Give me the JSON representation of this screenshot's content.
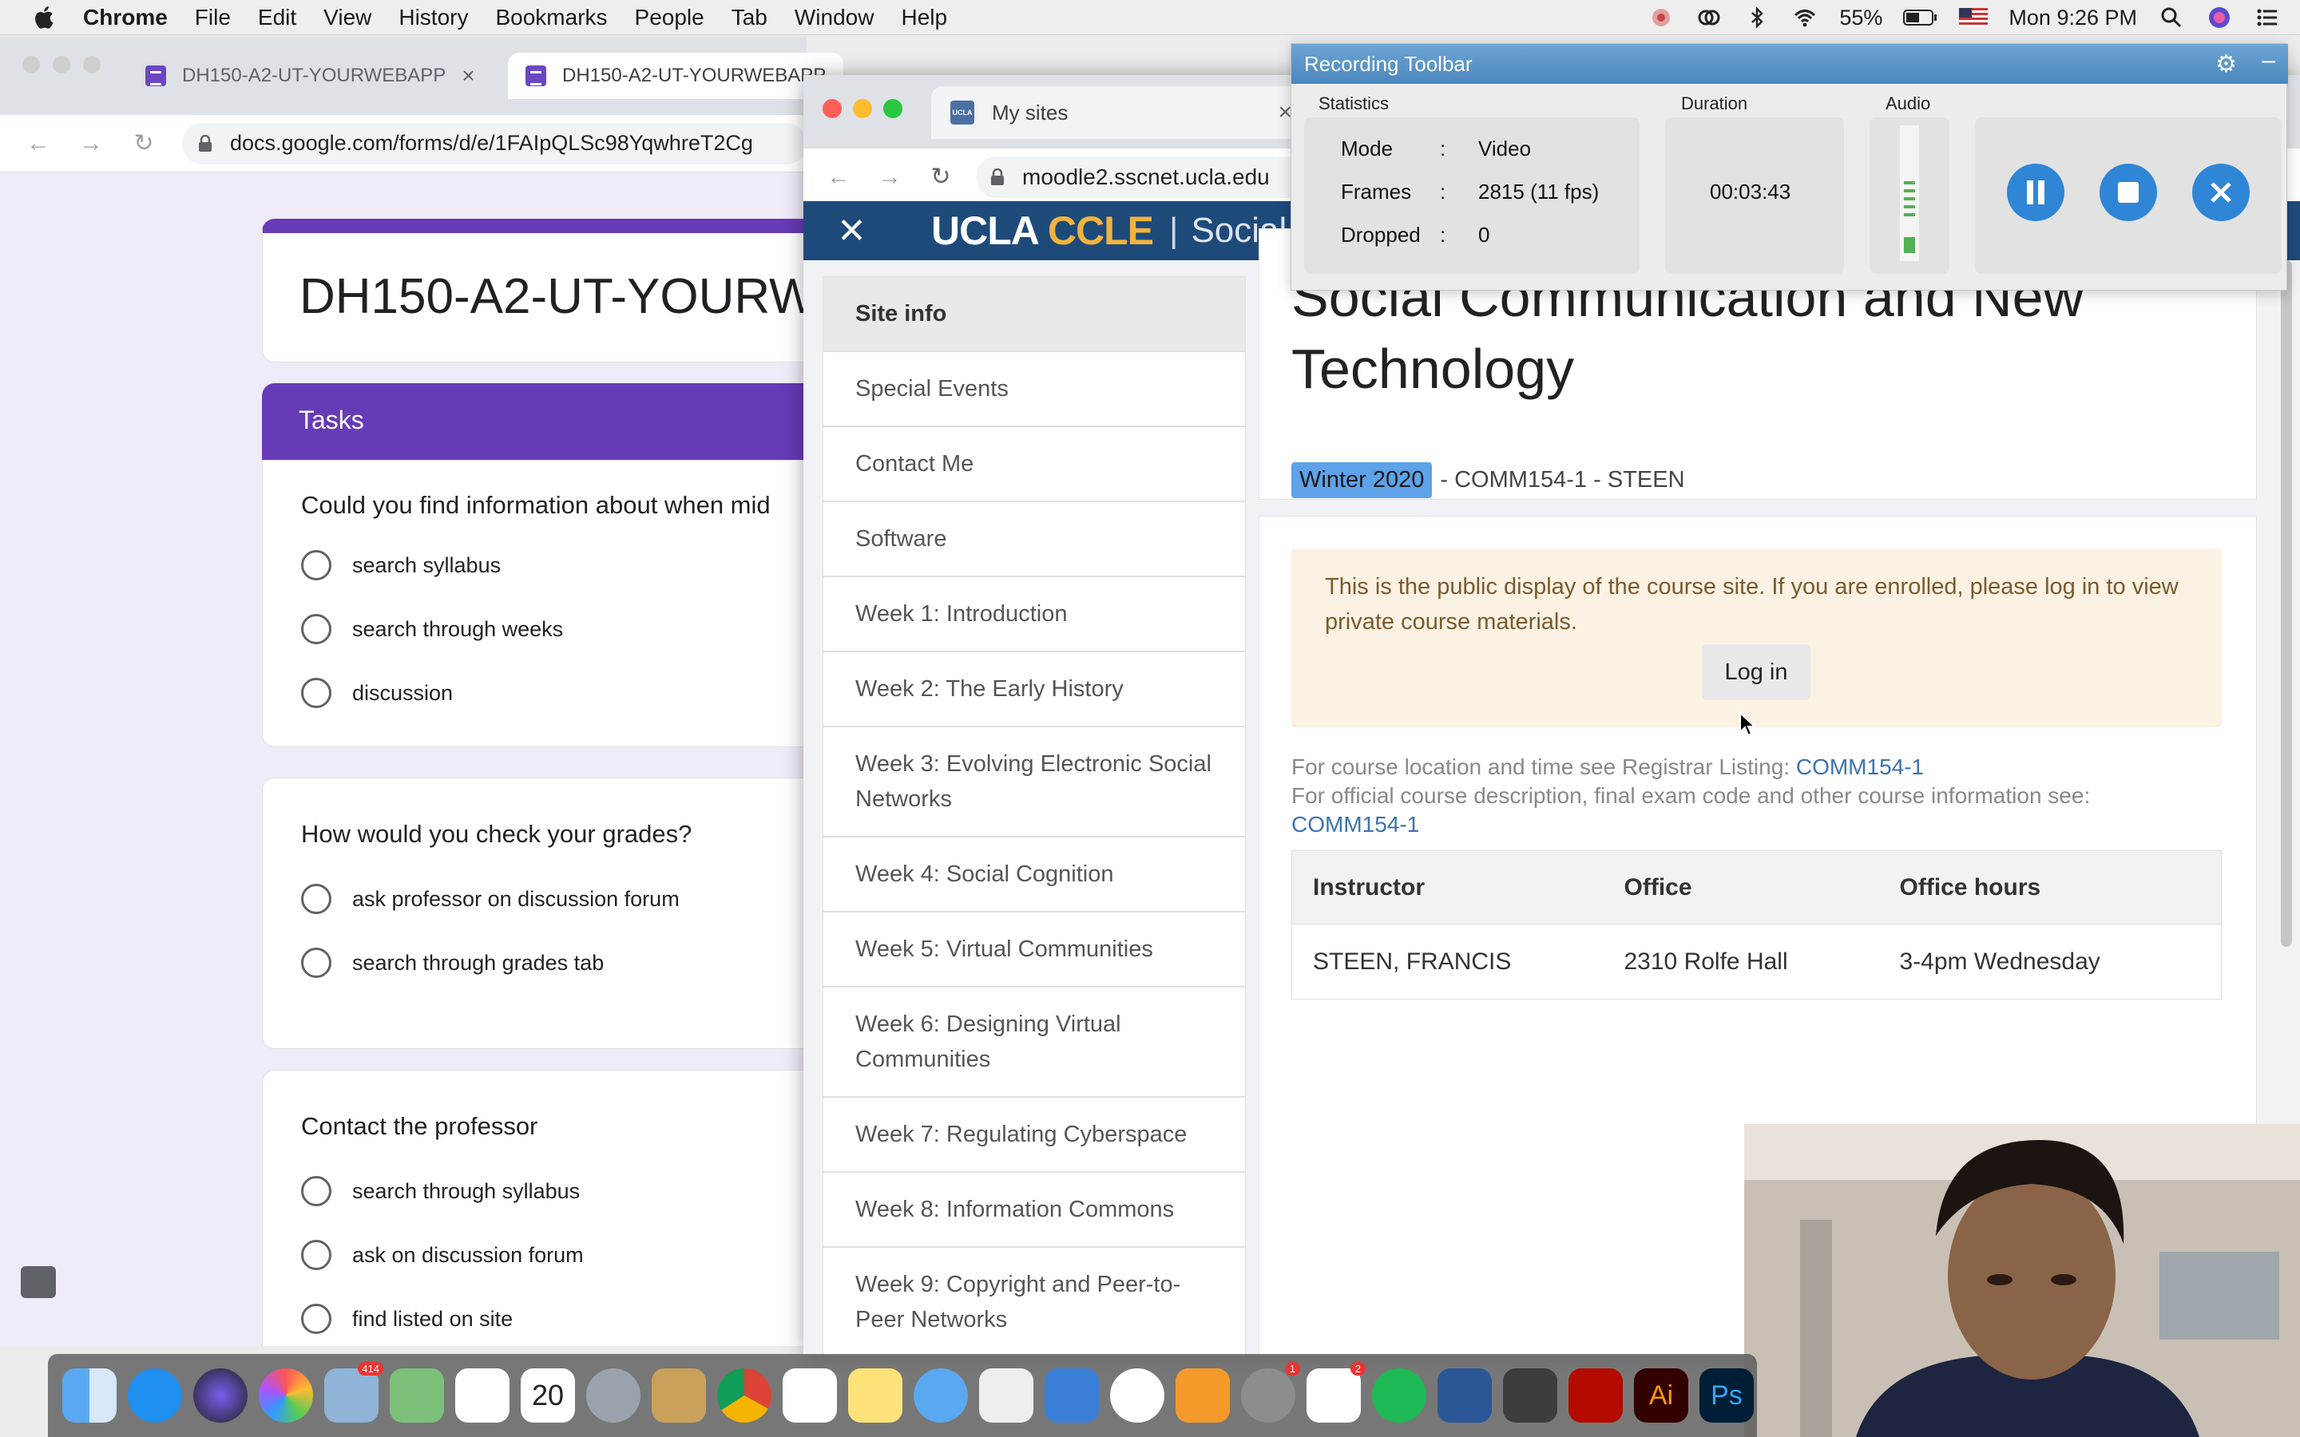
{
  "menubar": {
    "app": "Chrome",
    "items": [
      "File",
      "Edit",
      "View",
      "History",
      "Bookmarks",
      "People",
      "Tab",
      "Window",
      "Help"
    ],
    "battery": "55%",
    "clock": "Mon 9:26 PM"
  },
  "chrome_back": {
    "tabs": [
      {
        "title": "DH150-A2-UT-YOURWEBAPP"
      },
      {
        "title": "DH150-A2-UT-YOURWEBAPP"
      }
    ],
    "url": "docs.google.com/forms/d/e/1FAIpQLSc98YqwhreT2Cg",
    "form": {
      "title": "DH150-A2-UT-YOURW",
      "section": "Tasks",
      "questions": [
        {
          "text": "Could you find information about when mid",
          "options": [
            "search syllabus",
            "search through weeks",
            "discussion"
          ]
        },
        {
          "text": "How would you check your grades?",
          "options": [
            "ask professor on discussion forum",
            "search through grades tab"
          ]
        },
        {
          "text": "Contact the professor",
          "options": [
            "search through syllabus",
            "ask on discussion forum",
            "find listed on site"
          ]
        }
      ]
    }
  },
  "moodle": {
    "tab_title": "My sites",
    "favicon_text": "UCLA",
    "url": "moodle2.sscnet.ucla.edu",
    "header": {
      "logo_left": "UCLA ",
      "logo_right": "CCLE",
      "separator": "|",
      "site": "Social S"
    },
    "nav": [
      "Site info",
      "Special Events",
      "Contact Me",
      "Software",
      "Week 1: Introduction",
      "Week 2: The Early History",
      "Week 3: Evolving Electronic Social Networks",
      "Week 4: Social Cognition",
      "Week 5: Virtual Communities",
      "Week 6: Designing Virtual Communities",
      "Week 7: Regulating Cyberspace",
      "Week 8: Information Commons",
      "Week 9: Copyright and Peer-to-Peer Networks"
    ],
    "course": {
      "title": "Social Communication and New Technology",
      "term": "Winter 2020",
      "code": " - COMM154-1 - STEEN"
    },
    "alert": "This is the public display of the course site. If you are enrolled, please log in to view private course materials.",
    "login_label": "Log in",
    "registrar_text": "For course location and time see Registrar Listing: ",
    "registrar_link": "COMM154-1",
    "official_text": "For official course description, final exam code and other course information see:",
    "official_link": "COMM154-1",
    "table": {
      "headers": [
        "Instructor",
        "Office",
        "Office hours"
      ],
      "rows": [
        [
          "STEEN, FRANCIS",
          "2310 Rolfe Hall",
          "3-4pm Wednesday"
        ]
      ]
    }
  },
  "recorder": {
    "title": "Recording Toolbar",
    "labels": {
      "stats": "Statistics",
      "duration": "Duration",
      "audio": "Audio"
    },
    "mode_label": "Mode",
    "mode": "Video",
    "frames_label": "Frames",
    "frames": "2815 (11 fps)",
    "dropped_label": "Dropped",
    "dropped": "0",
    "colon": ":",
    "duration": "00:03:43"
  },
  "dock": {
    "calendar_date": "20",
    "badges": {
      "mail": "414",
      "sysprefs": "1",
      "slack": "2"
    }
  },
  "colors": {
    "forms_purple": "#673ab7",
    "ucla_blue": "#1e4a7a",
    "ucla_gold": "#f2b33d",
    "rec_blue": "#2f86d6"
  }
}
